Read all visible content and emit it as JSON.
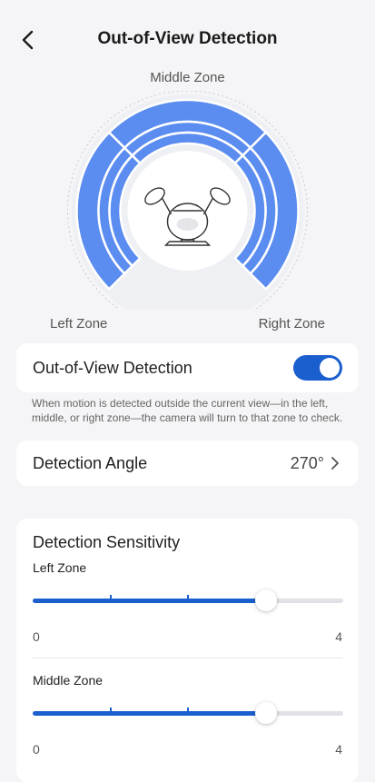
{
  "header": {
    "title": "Out-of-View Detection",
    "back_icon": "chevron-left-icon"
  },
  "diagram": {
    "middle_zone": "Middle Zone",
    "left_zone": "Left Zone",
    "right_zone": "Right Zone",
    "accent_color": "#5b8cf0",
    "icon": "ptz-camera-icon"
  },
  "toggle": {
    "label": "Out-of-View Detection",
    "on": true,
    "color": "#1b5fcf"
  },
  "description": "When motion is detected outside the current view—in the left, middle, or right zone—the camera will turn to that zone to check.",
  "angle": {
    "label": "Detection Angle",
    "value": "270°",
    "chevron_icon": "chevron-right-icon"
  },
  "sensitivity": {
    "title": "Detection Sensitivity",
    "sliders": [
      {
        "label": "Left Zone",
        "value": 3,
        "min": "0",
        "max": "4"
      },
      {
        "label": "Middle Zone",
        "value": 3,
        "min": "0",
        "max": "4"
      }
    ]
  }
}
